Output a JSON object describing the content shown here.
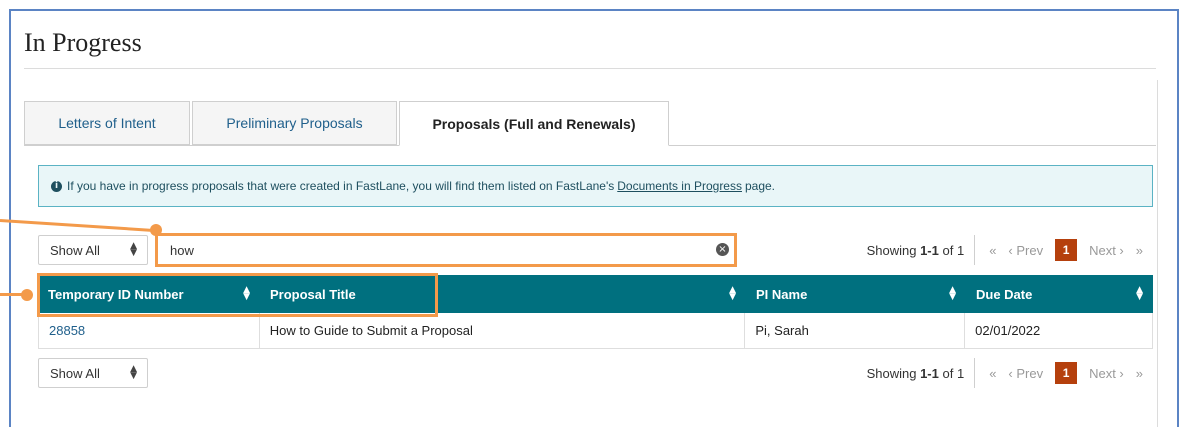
{
  "page": {
    "title": "In Progress"
  },
  "tabs": [
    {
      "label": "Letters of Intent",
      "active": false
    },
    {
      "label": "Preliminary Proposals",
      "active": false
    },
    {
      "label": "Proposals (Full and Renewals)",
      "active": true
    }
  ],
  "alert": {
    "text_before": "If you have in progress proposals that were created in FastLane, you will find them listed on FastLane's",
    "link": "Documents in Progress",
    "text_after": "page.",
    "icon": "info-icon"
  },
  "filter": {
    "selected": "Show All"
  },
  "search": {
    "value": "how"
  },
  "pagination": {
    "showing_prefix": "Showing",
    "showing_range": "1-1",
    "showing_suffix": "of 1",
    "first": "«",
    "prev": "‹ Prev",
    "current": "1",
    "next": "Next ›",
    "last": "»"
  },
  "table": {
    "columns": [
      "Temporary ID Number",
      "Proposal Title",
      "PI Name",
      "Due Date"
    ],
    "rows": [
      {
        "id": "28858",
        "title": "How to Guide to Submit a Proposal",
        "pi": "Pi, Sarah",
        "due": "02/01/2022"
      }
    ]
  },
  "colors": {
    "header_bg": "#00707f",
    "highlight": "#f39a4a",
    "pager_current": "#b5400d",
    "alert_bg": "#e9f6f8"
  }
}
